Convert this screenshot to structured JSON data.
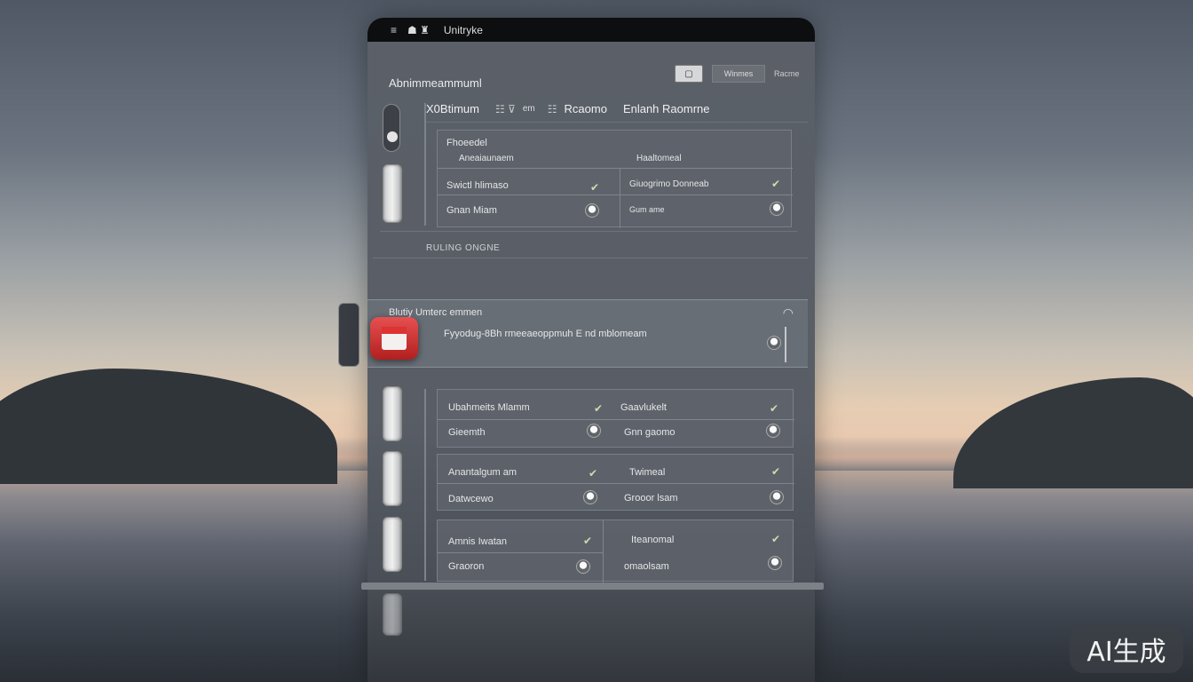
{
  "topbar": {
    "menu_icon": "≡",
    "app_icons": "☗ ♜",
    "title": "Unitryke"
  },
  "panel": {
    "title": "Abnimmeammuml",
    "controls": {
      "square_label": "▢",
      "button_label": "Winmes",
      "link_label": "Racme"
    }
  },
  "tabs": [
    {
      "label": "X0Btimum"
    },
    {
      "label": "☷ ⊽",
      "kind": "icons"
    },
    {
      "label": "em",
      "kind": "mini"
    },
    {
      "label": "☷",
      "kind": "icon"
    },
    {
      "label": "Rcaomo"
    },
    {
      "label": "Enlanh Raomrne"
    }
  ],
  "card1": {
    "header": "Fhoeedel",
    "sub_left": "Aneaiaunaem",
    "sub_right": "Haaltomeal",
    "rows": [
      {
        "left": "Swictl hlimaso",
        "right": "Giuogrimo Donneab"
      },
      {
        "left": "Gnan Miam",
        "right": "Gum ame"
      }
    ]
  },
  "section_label": "RULING ONGNE",
  "notification": {
    "title": "Blutiy Umterc emmen",
    "message": "Fyyodug-8Bh rmeeaeoppmuh E nd mblomeam"
  },
  "card2": {
    "rows": [
      {
        "left": "Ubahmeits Mlamm",
        "right": "Gaavlukelt"
      },
      {
        "left": "Gieemth",
        "right": "Gnn gaomo"
      }
    ]
  },
  "card3": {
    "rows": [
      {
        "left": "Anantalgum am",
        "right": "Twimeal"
      },
      {
        "left": "Datwcewo",
        "right": "Grooor lsam"
      }
    ]
  },
  "card4": {
    "rows": [
      {
        "left": "Amnis Iwatan",
        "right": "Iteanomal"
      },
      {
        "left": "Graoron",
        "right": "omaolsam"
      }
    ]
  },
  "watermark": "AI生成",
  "icons": {
    "check": "✔",
    "gauge": "◠"
  },
  "colors": {
    "accent_red": "#d93636",
    "check_green": "#c9ddb2",
    "panel_bg": "#5b6068"
  }
}
